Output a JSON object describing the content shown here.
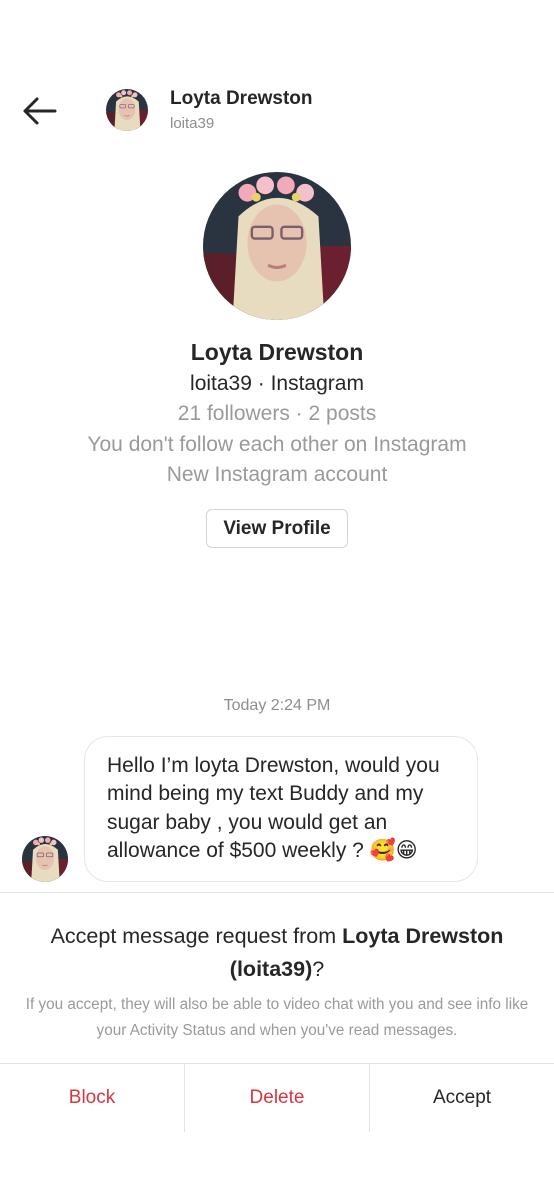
{
  "header": {
    "name": "Loyta Drewston",
    "handle": "loita39"
  },
  "profile": {
    "name": "Loyta Drewston",
    "subtitle": "loita39 · Instagram",
    "stats": "21 followers · 2 posts",
    "follow_status": "You don't follow each other on Instagram",
    "account_note": "New Instagram account",
    "view_profile_label": "View Profile"
  },
  "chat": {
    "timestamp": "Today 2:24 PM",
    "message": "Hello I’m loyta Drewston, would you mind being my text Buddy and my sugar baby , you would get an allowance of $500 weekly ? 🥰😁"
  },
  "request": {
    "title_prefix": "Accept message request from ",
    "title_name": "Loyta Drewston",
    "title_handle": "(loita39)",
    "title_suffix": "?",
    "info": "If you accept, they will also be able to video chat with you and see info like your Activity Status and when you've read messages."
  },
  "actions": {
    "block": "Block",
    "delete": "Delete",
    "accept": "Accept"
  },
  "colors": {
    "danger": "#d9363e",
    "text": "#262626",
    "muted": "#8e8e8e"
  }
}
